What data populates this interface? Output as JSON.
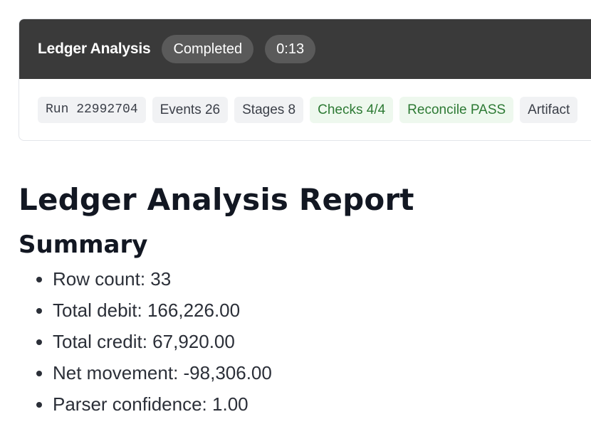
{
  "header": {
    "title": "Ledger Analysis",
    "status": "Completed",
    "elapsed": "0:13"
  },
  "chips": [
    {
      "label": "Run 22992704",
      "tone": "neutral",
      "mono": true
    },
    {
      "label": "Events 26",
      "tone": "neutral"
    },
    {
      "label": "Stages 8",
      "tone": "neutral"
    },
    {
      "label": "Checks 4/4",
      "tone": "success"
    },
    {
      "label": "Reconcile PASS",
      "tone": "success"
    },
    {
      "label": "Artifact",
      "tone": "neutral"
    }
  ],
  "report": {
    "title": "Ledger Analysis Report",
    "summary_heading": "Summary",
    "summary_items": [
      "Row count: 33",
      "Total debit: 166,226.00",
      "Total credit: 67,920.00",
      "Net movement: -98,306.00",
      "Parser confidence: 1.00"
    ]
  },
  "colors": {
    "header_bg": "#3a3a3a",
    "pill_bg": "#5a5a5a",
    "chip_neutral_bg": "#f1f2f4",
    "chip_success_bg": "#eef8ee",
    "chip_success_text": "#2d7a34"
  }
}
